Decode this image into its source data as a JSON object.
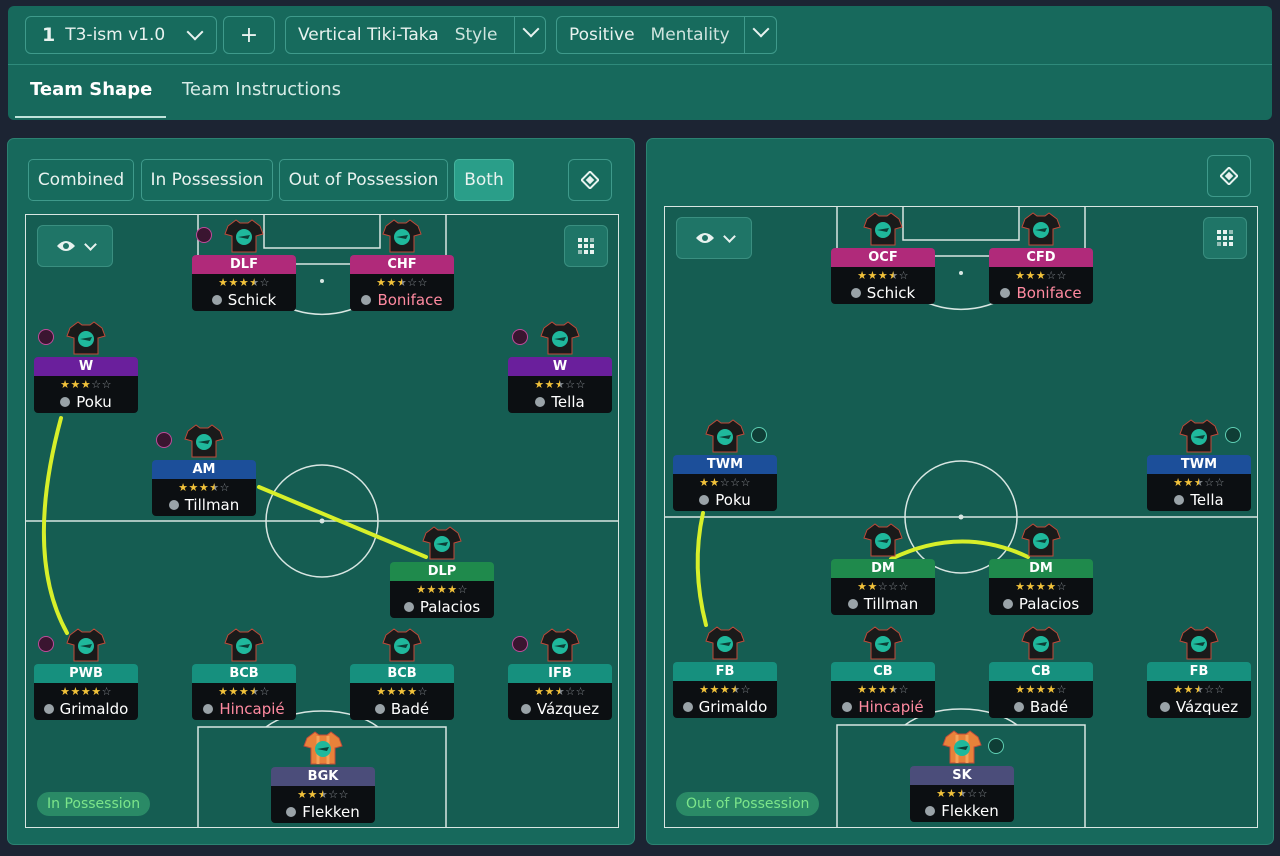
{
  "topbar": {
    "tactic_number": "1",
    "tactic_name": "T3-ism v1.0",
    "add_label": "+",
    "style_value": "Vertical Tiki-Taka",
    "style_label": "Style",
    "mentality_value": "Positive",
    "mentality_label": "Mentality",
    "tabs": [
      "Team Shape",
      "Team Instructions"
    ],
    "active_tab": "Team Shape"
  },
  "left_panel": {
    "filters": [
      "Combined",
      "In Possession",
      "Out of Possession",
      "Both"
    ],
    "active_filter": "Both",
    "state_label": "In Possession",
    "players": [
      {
        "role": "DLF",
        "stars": "★★★★☆",
        "rating": 3.5,
        "name": "Schick",
        "color": "#b02a7a",
        "highlight": false,
        "marker": "pos"
      },
      {
        "role": "CHF",
        "stars": "★★★☆☆",
        "rating": 2.5,
        "name": "Boniface",
        "color": "#b02a7a",
        "highlight": true,
        "marker": "none"
      },
      {
        "role": "W",
        "stars": "★★★☆☆",
        "rating": 3,
        "name": "Poku",
        "color": "#6a1f9c",
        "highlight": false,
        "marker": "pos"
      },
      {
        "role": "W",
        "stars": "★★★☆☆",
        "rating": 2.5,
        "name": "Tella",
        "color": "#6a1f9c",
        "highlight": false,
        "marker": "pos"
      },
      {
        "role": "AM",
        "stars": "★★★★☆",
        "rating": 3.5,
        "name": "Tillman",
        "color": "#1c4f9a",
        "highlight": false,
        "marker": "pos"
      },
      {
        "role": "DLP",
        "stars": "★★★★☆",
        "rating": 4,
        "name": "Palacios",
        "color": "#1f8a4c",
        "highlight": false,
        "marker": "none"
      },
      {
        "role": "PWB",
        "stars": "★★★★☆",
        "rating": 4,
        "name": "Grimaldo",
        "color": "#16907e",
        "highlight": false,
        "marker": "pos"
      },
      {
        "role": "BCB",
        "stars": "★★★★☆",
        "rating": 3.5,
        "name": "Hincapié",
        "color": "#16907e",
        "highlight": true,
        "marker": "none"
      },
      {
        "role": "BCB",
        "stars": "★★★★☆",
        "rating": 4,
        "name": "Badé",
        "color": "#16907e",
        "highlight": false,
        "marker": "none"
      },
      {
        "role": "IFB",
        "stars": "★★★☆☆",
        "rating": 2.5,
        "name": "Vázquez",
        "color": "#16907e",
        "highlight": false,
        "marker": "pos"
      },
      {
        "role": "BGK",
        "stars": "★★★☆☆",
        "rating": 2.5,
        "name": "Flekken",
        "color": "#4b4d7a",
        "highlight": false,
        "marker": "none",
        "keeper": true
      }
    ]
  },
  "right_panel": {
    "state_label": "Out of Possession",
    "players": [
      {
        "role": "OCF",
        "stars": "★★★★☆",
        "rating": 3.5,
        "name": "Schick",
        "color": "#b02a7a",
        "highlight": false,
        "marker": "none"
      },
      {
        "role": "CFD",
        "stars": "★★★☆☆",
        "rating": 3,
        "name": "Boniface",
        "color": "#b02a7a",
        "highlight": true,
        "marker": "none"
      },
      {
        "role": "TWM",
        "stars": "★★☆☆☆",
        "rating": 2,
        "name": "Poku",
        "color": "#1c4f9a",
        "highlight": false,
        "marker": "oop"
      },
      {
        "role": "TWM",
        "stars": "★★★☆☆",
        "rating": 2.5,
        "name": "Tella",
        "color": "#1c4f9a",
        "highlight": false,
        "marker": "oop"
      },
      {
        "role": "DM",
        "stars": "★★☆☆☆",
        "rating": 2,
        "name": "Tillman",
        "color": "#1f8a4c",
        "highlight": false,
        "marker": "none"
      },
      {
        "role": "DM",
        "stars": "★★★★☆",
        "rating": 4,
        "name": "Palacios",
        "color": "#1f8a4c",
        "highlight": false,
        "marker": "none"
      },
      {
        "role": "FB",
        "stars": "★★★★☆",
        "rating": 3.5,
        "name": "Grimaldo",
        "color": "#16907e",
        "highlight": false,
        "marker": "none"
      },
      {
        "role": "CB",
        "stars": "★★★★☆",
        "rating": 3.5,
        "name": "Hincapié",
        "color": "#16907e",
        "highlight": true,
        "marker": "none"
      },
      {
        "role": "CB",
        "stars": "★★★★☆",
        "rating": 4,
        "name": "Badé",
        "color": "#16907e",
        "highlight": false,
        "marker": "none"
      },
      {
        "role": "FB",
        "stars": "★★★☆☆",
        "rating": 2.5,
        "name": "Vázquez",
        "color": "#16907e",
        "highlight": false,
        "marker": "none"
      },
      {
        "role": "SK",
        "stars": "★★★☆☆",
        "rating": 2.5,
        "name": "Flekken",
        "color": "#4b4d7a",
        "highlight": false,
        "marker": "oop",
        "keeper": true
      }
    ]
  },
  "icons": {
    "eye": "eye-icon",
    "chevron": "chevron-down-icon",
    "grid": "grid-icon",
    "diamond": "diamond-icon",
    "player_portrait": "person-icon"
  },
  "colors": {
    "accent": "#2a9e89",
    "link_line": "#d7ef2a",
    "highlight_name": "#ff8aa0",
    "star": "#f2c23a"
  }
}
